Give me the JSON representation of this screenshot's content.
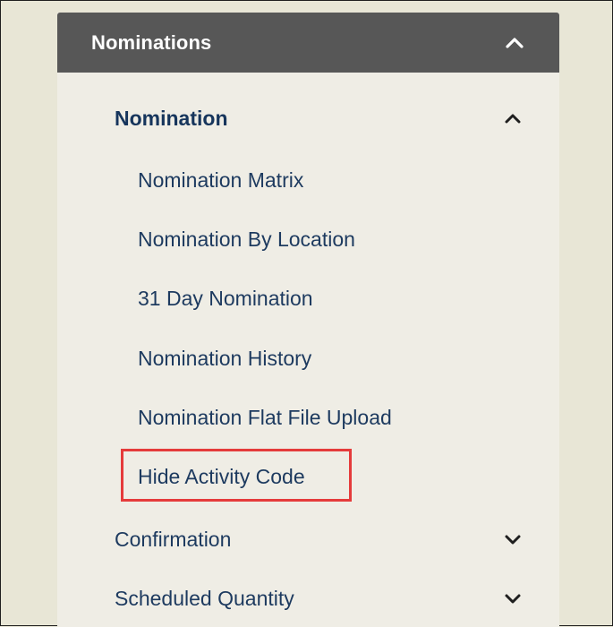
{
  "menu": {
    "header": {
      "title": "Nominations",
      "icon": "chevron-up-icon"
    },
    "sections": [
      {
        "label": "Nomination",
        "expanded": true,
        "icon": "chevron-up-icon",
        "items": [
          {
            "label": "Nomination Matrix"
          },
          {
            "label": "Nomination By Location"
          },
          {
            "label": "31 Day Nomination"
          },
          {
            "label": "Nomination History"
          },
          {
            "label": "Nomination Flat File Upload"
          },
          {
            "label": "Hide Activity Code",
            "highlighted": true
          }
        ]
      },
      {
        "label": "Confirmation",
        "expanded": false,
        "icon": "chevron-down-icon"
      },
      {
        "label": "Scheduled Quantity",
        "expanded": false,
        "icon": "chevron-down-icon"
      }
    ]
  },
  "colors": {
    "page_background": "#e8e6d6",
    "panel_background": "#efede5",
    "header_background": "#575757",
    "header_text": "#ffffff",
    "link_text": "#1d3a5f",
    "highlight_border": "#e53b3b"
  }
}
